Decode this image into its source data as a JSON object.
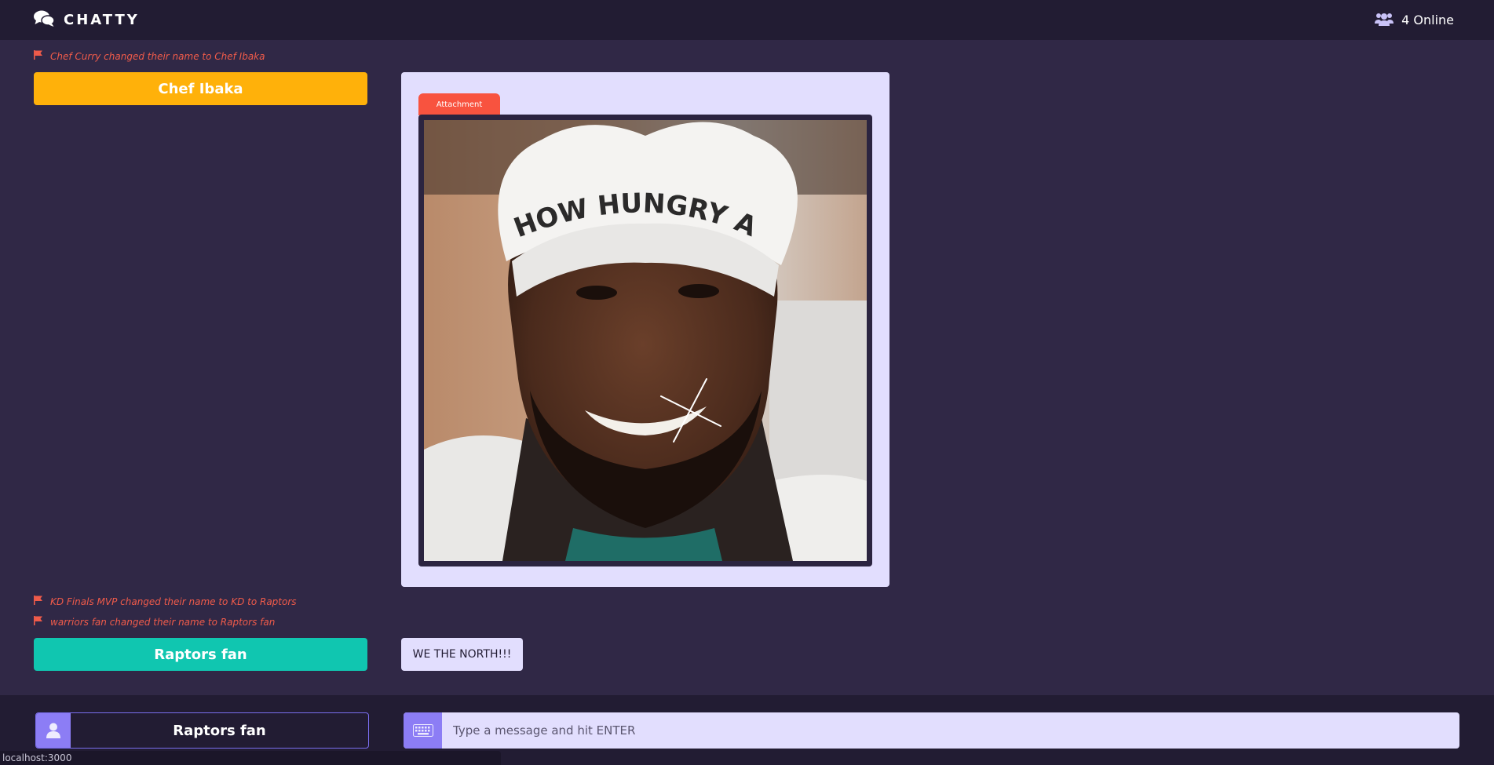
{
  "app": {
    "brand": "CHATTY",
    "brand_icon": "chat-bubbles-icon",
    "online_icon": "users-icon",
    "online_label": "4 Online"
  },
  "feed": {
    "notices": [
      {
        "text": "Chef Curry changed their name to Chef Ibaka",
        "icon": "flag-icon"
      },
      {
        "text": "KD Finals MVP changed their name to KD to Raptors",
        "icon": "flag-icon"
      },
      {
        "text": "warriors fan changed their name to Raptors fan",
        "icon": "flag-icon"
      }
    ],
    "groups": [
      {
        "user": "Chef Ibaka",
        "color": "#ffb10a",
        "attachment_label": "Attachment",
        "attachment_hat_text": "HOW HUNGRY ARE YOU"
      },
      {
        "user": "Raptors fan",
        "color": "#10c6b0",
        "message": "WE THE NORTH!!!"
      }
    ]
  },
  "composer": {
    "name_icon": "user-icon",
    "name_value": "Raptors fan",
    "message_icon": "keyboard-icon",
    "message_placeholder": "Type a message and hit ENTER",
    "message_value": ""
  },
  "status_bar": {
    "url": "localhost:3000"
  },
  "colors": {
    "background": "#302846",
    "bars": "#221c33",
    "accent": "#8c7df5",
    "bubble": "#e2defe",
    "notice": "#f05b4a",
    "attachment_tag": "#f8533f"
  }
}
